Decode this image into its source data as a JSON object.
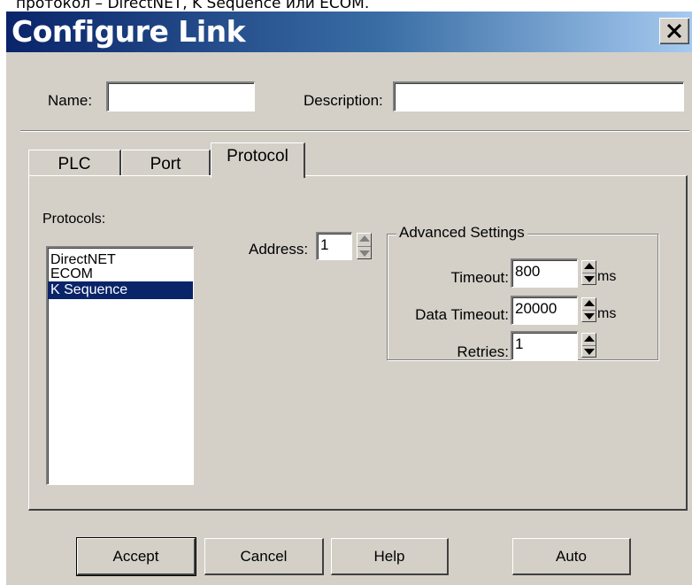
{
  "top_strip_text": "протокол – DirectNET, K Sequence или ECOM.",
  "dialog": {
    "title": "Configure Link",
    "close_glyph": "✕"
  },
  "name_label": "Name:",
  "name_value": "",
  "description_label": "Description:",
  "description_value": "",
  "tabs": [
    {
      "label": "PLC"
    },
    {
      "label": "Port"
    },
    {
      "label": "Protocol",
      "active": true
    }
  ],
  "protocols": {
    "label": "Protocols:",
    "items": [
      "DirectNET",
      "ECOM",
      "K Sequence"
    ],
    "selected": "K Sequence"
  },
  "address": {
    "label": "Address:",
    "value": "1"
  },
  "advanced": {
    "title": "Advanced Settings",
    "timeout_label": "Timeout:",
    "timeout_value": "800",
    "timeout_unit": "ms",
    "data_timeout_label": "Data Timeout:",
    "data_timeout_value": "20000",
    "data_timeout_unit": "ms",
    "retries_label": "Retries:",
    "retries_value": "1"
  },
  "buttons": {
    "accept": "Accept",
    "cancel": "Cancel",
    "help": "Help",
    "auto": "Auto"
  },
  "colors": {
    "title_gradient_start": "#0a246a",
    "title_gradient_end": "#a6caf0",
    "dialog_face": "#d4d0c8",
    "selection": "#0a246a"
  }
}
